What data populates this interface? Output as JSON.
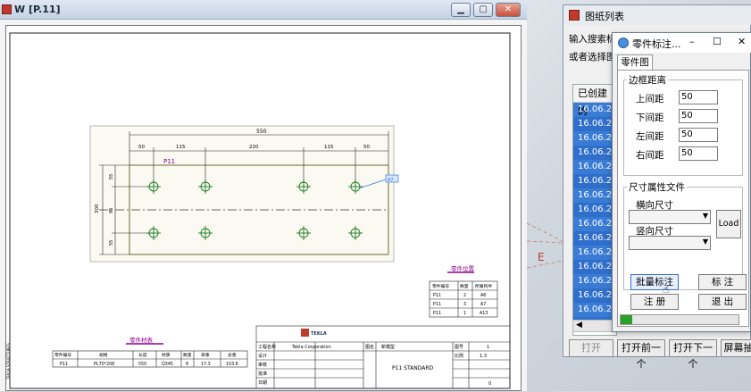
{
  "drawing_window": {
    "title": "W   [P.11]",
    "controls": {
      "minimize": "▁",
      "maximize": "▢",
      "close": "✕"
    }
  },
  "drawing": {
    "part_label": "P11",
    "dim_overall": "550",
    "dims_top": [
      "50",
      "115",
      "220",
      "115",
      "50"
    ],
    "dims_left": [
      "55",
      "300",
      "95",
      "55"
    ],
    "balloon": "A7",
    "parts_table": {
      "title": "零件位置",
      "headers": [
        "零件编号",
        "数量",
        "所属构件"
      ],
      "rows": [
        [
          "P11",
          "2",
          "A6"
        ],
        [
          "P11",
          "3",
          "A7"
        ],
        [
          "P11",
          "1",
          "A13"
        ]
      ]
    },
    "bom_table": {
      "title": "零件材表",
      "headers": [
        "零件编号",
        "规格",
        "长度",
        "材质",
        "数量",
        "单重",
        "总重"
      ],
      "row": [
        "P11",
        "PL70*208",
        "550",
        "Q345",
        "8",
        "17.3",
        "103.6"
      ]
    },
    "title_block": {
      "logo": "TEKLA",
      "company": "Tekla Corporation",
      "model_label": "工程名称",
      "name_label": "图名",
      "standard": "P11 STANDARD",
      "scale_label": "比例",
      "scale": "1:3",
      "sheet_label": "图号",
      "sheet": "1",
      "rev": "0",
      "rows": [
        "设计",
        "审核",
        "批准",
        "日期"
      ],
      "proj_label": "新模型"
    },
    "side_text": "TEKLA STRUCTURES"
  },
  "list_window": {
    "title": "图纸列表",
    "search_label": "输入搜索标",
    "select_label": "或者选择图纸",
    "column": "已创建的",
    "rows": [
      "16.06.2...",
      "16.06.2...",
      "16.06.2...",
      "16.06.2...",
      "16.06.2...",
      "16.06.2...",
      "16.06.2...",
      "16.06.2...",
      "16.06.2...",
      "16.06.2...",
      "16.06.2...",
      "16.06.2...",
      "16.06.2...",
      "16.06.2...",
      "16.06.2...",
      "16.06.2..."
    ],
    "buttons": {
      "open": "打开",
      "prev": "打开前一个",
      "next": "打开下一个",
      "screen": "屏幕抽"
    }
  },
  "dim_dialog": {
    "title": "零件标注...",
    "controls": {
      "minimize": "–",
      "maximize": "☐",
      "close": "✕"
    },
    "tab": "零件图",
    "group_margin": {
      "title": "边框距离",
      "top_label": "上间距",
      "top_value": "50",
      "bottom_label": "下间距",
      "bottom_value": "50",
      "left_label": "左间距",
      "left_value": "50",
      "right_label": "右间距",
      "right_value": "50"
    },
    "group_attr": {
      "title": "尺寸属性文件",
      "horizontal_label": "横向尺寸",
      "vertical_label": "竖向尺寸",
      "load_button": "Load"
    },
    "buttons": {
      "batch": "批量标注",
      "annotate": "标 注",
      "register": "注 册",
      "exit": "退 出"
    },
    "progress": 0.1
  },
  "colors": {
    "accent": "#3a7bd5",
    "drawing_line": "#556b2f",
    "dim_line": "#222222"
  }
}
